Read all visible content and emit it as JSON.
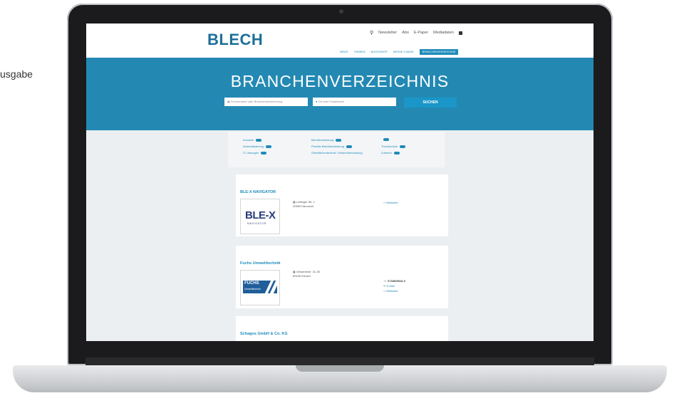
{
  "side_text": "usgabe",
  "site": {
    "logo": "BLECH",
    "topmenu": {
      "search_icon": "search-icon",
      "items": [
        "Newsletter",
        "Abo",
        "E-Paper",
        "Mediadaten"
      ],
      "extra_icon": "grid-icon"
    },
    "nav": [
      "NEWS",
      "THEMEN",
      "BLECHSHOP",
      "MESSE X-BAND",
      "BRANCHENVERZEICHNIS"
    ],
    "hero_title": "BRANCHENVERZEICHNIS",
    "search": {
      "keyword_placeholder": "Firmenname oder Branchenbezeichnung",
      "location_placeholder": "Ort oder Postleitzahl",
      "button": "SUCHEN"
    },
    "categories": {
      "col1": [
        "Industrie",
        "Automatisierung",
        "IT Lösungen"
      ],
      "col2": [
        "Blechbearbeitung",
        "Flexible Blechbearbeitung",
        "Oberflächentechnik / Wärmebehandlung"
      ],
      "col3": [
        "",
        "Trenntechnik",
        "Zubehör"
      ]
    },
    "cards": [
      {
        "title": "BLE-X NAVIGATOR",
        "logo_text": "BLE-X",
        "logo_sub": "NAVIGATOR",
        "address": [
          "Luftinger Str. 1",
          "30559 Hannover"
        ],
        "contact": [
          "Webseite"
        ]
      },
      {
        "title": "Fuchs Umwelttechnik",
        "logo_text": "FUCHS",
        "logo_sub": "Umwelttechnik",
        "address": [
          "Gewerbestr. 31-35",
          "89155 Erbach"
        ],
        "phone": "07346/9616-0",
        "contact": [
          "E-Mail",
          "Webseite"
        ]
      },
      {
        "title": "Schagos GmbH & Co. KG"
      }
    ]
  }
}
